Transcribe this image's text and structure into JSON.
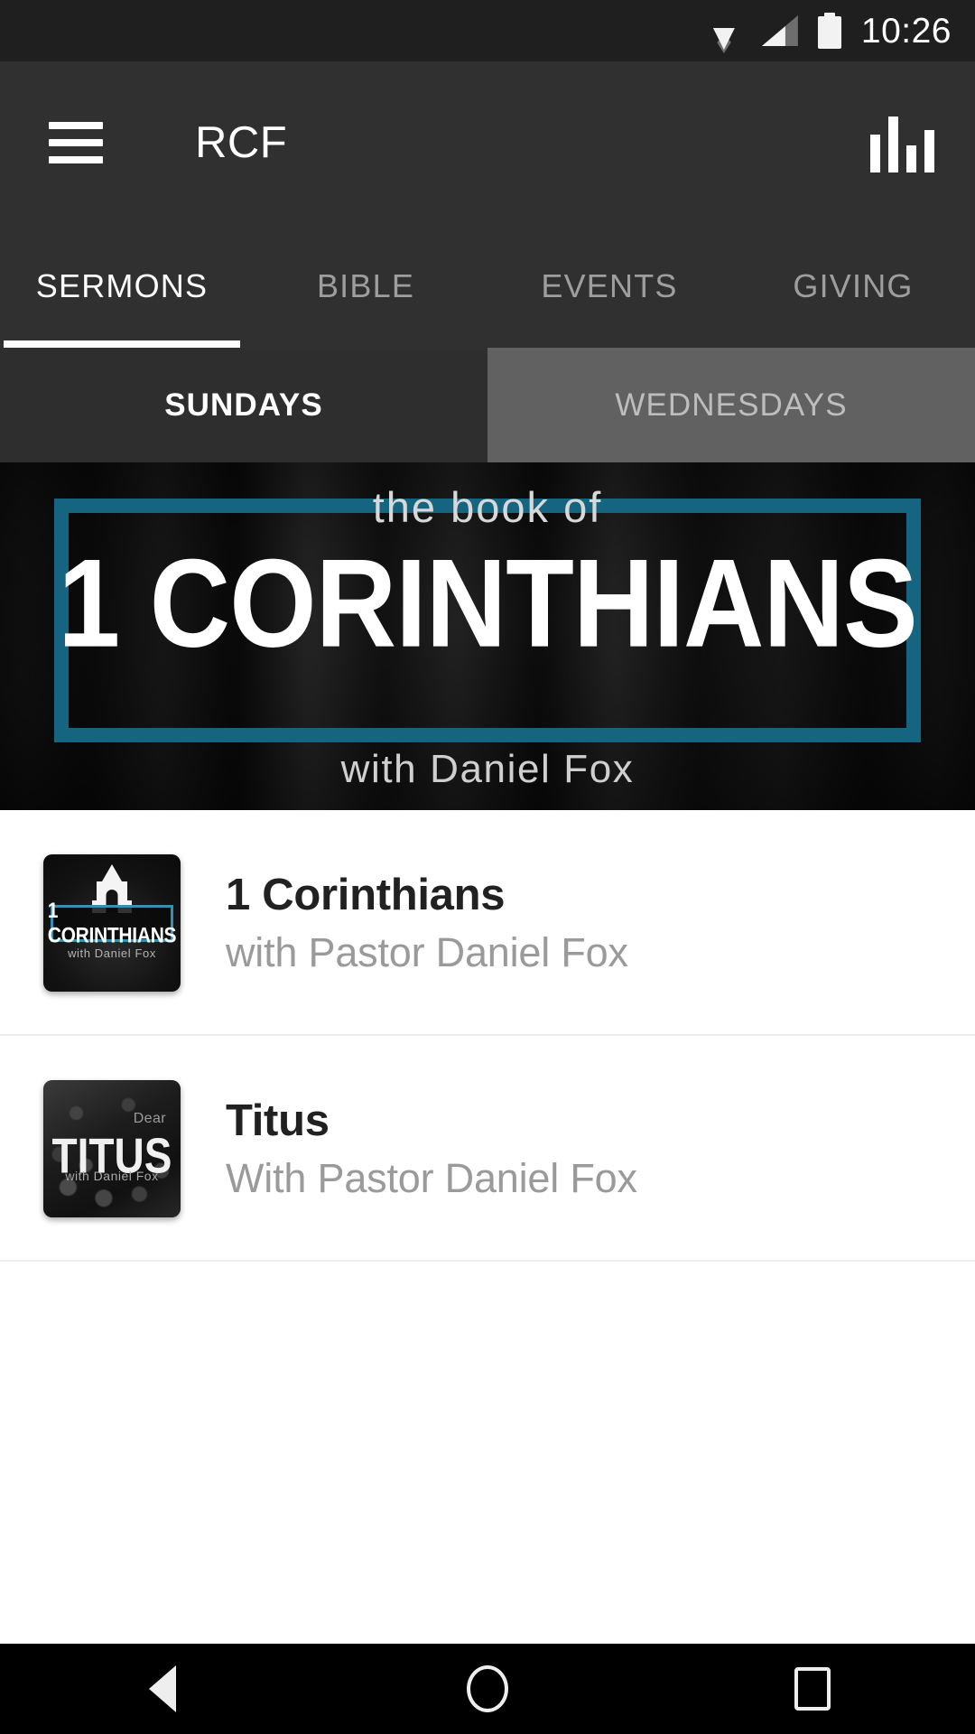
{
  "status_bar": {
    "time": "10:26",
    "icons": [
      "wifi-icon",
      "cellular-signal-icon",
      "battery-icon"
    ]
  },
  "app_bar": {
    "menu_icon": "hamburger-menu-icon",
    "title": "RCF",
    "action_icon": "equalizer-icon"
  },
  "tabs": [
    {
      "label": "SERMONS",
      "active": true
    },
    {
      "label": "BIBLE",
      "active": false
    },
    {
      "label": "EVENTS",
      "active": false
    },
    {
      "label": "GIVING",
      "active": false
    }
  ],
  "sub_tabs": [
    {
      "label": "SUNDAYS",
      "active": true
    },
    {
      "label": "WEDNESDAYS",
      "active": false
    }
  ],
  "hero": {
    "kicker": "the book of",
    "title": "1 CORINTHIANS",
    "subtitle": "with Daniel Fox",
    "frame_color": "#156480"
  },
  "series_list": [
    {
      "title": "1 Corinthians",
      "subtitle": "with Pastor Daniel Fox",
      "thumbnail": {
        "icon": "church-steeple-icon",
        "box_label": "1 CORINTHIANS",
        "caption": "with Daniel Fox",
        "accent": "#2e93b5"
      }
    },
    {
      "title": "Titus",
      "subtitle": "With Pastor Daniel Fox",
      "thumbnail": {
        "kicker": "Dear",
        "box_label": "TITUS",
        "caption": "with Daniel Fox"
      }
    }
  ],
  "nav_bar": {
    "back": "back-triangle-icon",
    "home": "home-circle-icon",
    "recents": "recents-square-icon"
  },
  "colors": {
    "app_bar_bg": "#303030",
    "status_bar_bg": "#1f1f1f",
    "subtab_active_bg": "#2e2e2e",
    "subtab_inactive_bg": "#616161",
    "accent_teal": "#156480",
    "content_bg": "#ffffff",
    "title_text": "#212121",
    "subtitle_text": "#9a9a9a"
  }
}
